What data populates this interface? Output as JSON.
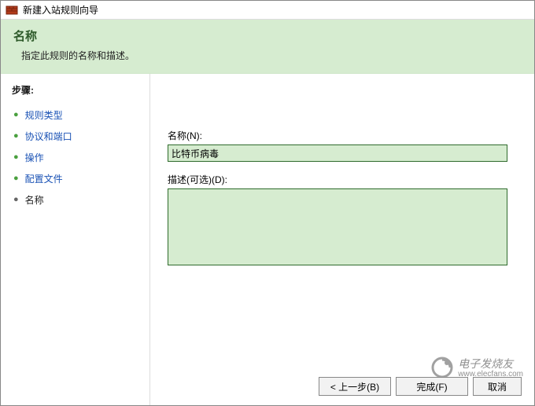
{
  "window": {
    "title": "新建入站规则向导"
  },
  "header": {
    "title": "名称",
    "description": "指定此规则的名称和描述。"
  },
  "sidebar": {
    "steps_title": "步骤:",
    "items": [
      {
        "label": "规则类型",
        "current": false
      },
      {
        "label": "协议和端口",
        "current": false
      },
      {
        "label": "操作",
        "current": false
      },
      {
        "label": "配置文件",
        "current": false
      },
      {
        "label": "名称",
        "current": true
      }
    ]
  },
  "form": {
    "name_label": "名称(N):",
    "name_value": "比特币病毒",
    "desc_label": "描述(可选)(D):",
    "desc_value": ""
  },
  "buttons": {
    "back": "< 上一步(B)",
    "finish": "完成(F)",
    "cancel": "取消"
  },
  "watermark": {
    "brand": "电子发烧友",
    "url": "www.elecfans.com"
  }
}
